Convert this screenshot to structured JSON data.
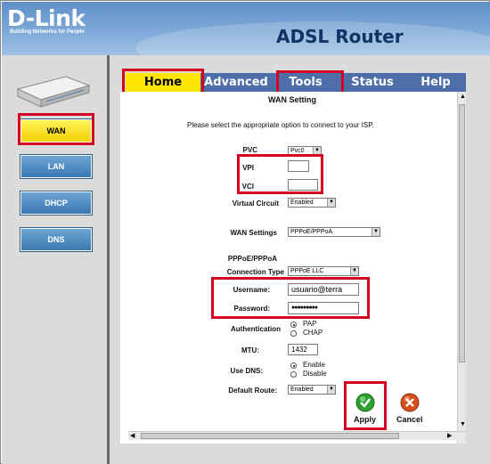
{
  "header": {
    "logo": "D-Link",
    "tagline": "Building Networks for People",
    "title": "ADSL Router"
  },
  "sidebar": {
    "items": [
      {
        "label": "WAN",
        "active": true
      },
      {
        "label": "LAN",
        "active": false
      },
      {
        "label": "DHCP",
        "active": false
      },
      {
        "label": "DNS",
        "active": false
      }
    ]
  },
  "tabs": [
    {
      "label": "Home"
    },
    {
      "label": "Advanced"
    },
    {
      "label": "Tools"
    },
    {
      "label": "Status"
    },
    {
      "label": "Help"
    }
  ],
  "form": {
    "title": "WAN Setting",
    "instruction": "Please select the appropriate option to connect to your ISP.",
    "pvc_label": "PVC",
    "pvc_value": "Pvc0",
    "vpi_label": "VPI",
    "vpi_value": "",
    "vci_label": "VCI",
    "vci_value": "",
    "virtual_circuit_label": "Virtual Circuit",
    "virtual_circuit_value": "Enabled",
    "wan_settings_label": "WAN Settings",
    "wan_settings_value": "PPPoE/PPPoA",
    "section_heading": "PPPoE/PPPoA",
    "connection_type_label": "Connection Type",
    "connection_type_value": "PPPoE LLC",
    "username_label": "Username:",
    "username_value": "usuario@terra",
    "password_label": "Password:",
    "password_value": "●●●●●●●●●",
    "authentication_label": "Authentication",
    "auth_options": [
      "PAP",
      "CHAP"
    ],
    "mtu_label": "MTU:",
    "mtu_value": "1432",
    "use_dns_label": "Use DNS:",
    "dns_options": [
      "Enable",
      "Disable"
    ],
    "default_route_label": "Default Route:",
    "default_route_value": "Enabled",
    "apply_label": "Apply",
    "cancel_label": "Cancel"
  },
  "colors": {
    "highlight": "#d3001f",
    "active_tab": "#ffe600",
    "nav_button": "#3a78b2",
    "apply_icon": "#2fa02f",
    "cancel_icon": "#d2501e"
  }
}
